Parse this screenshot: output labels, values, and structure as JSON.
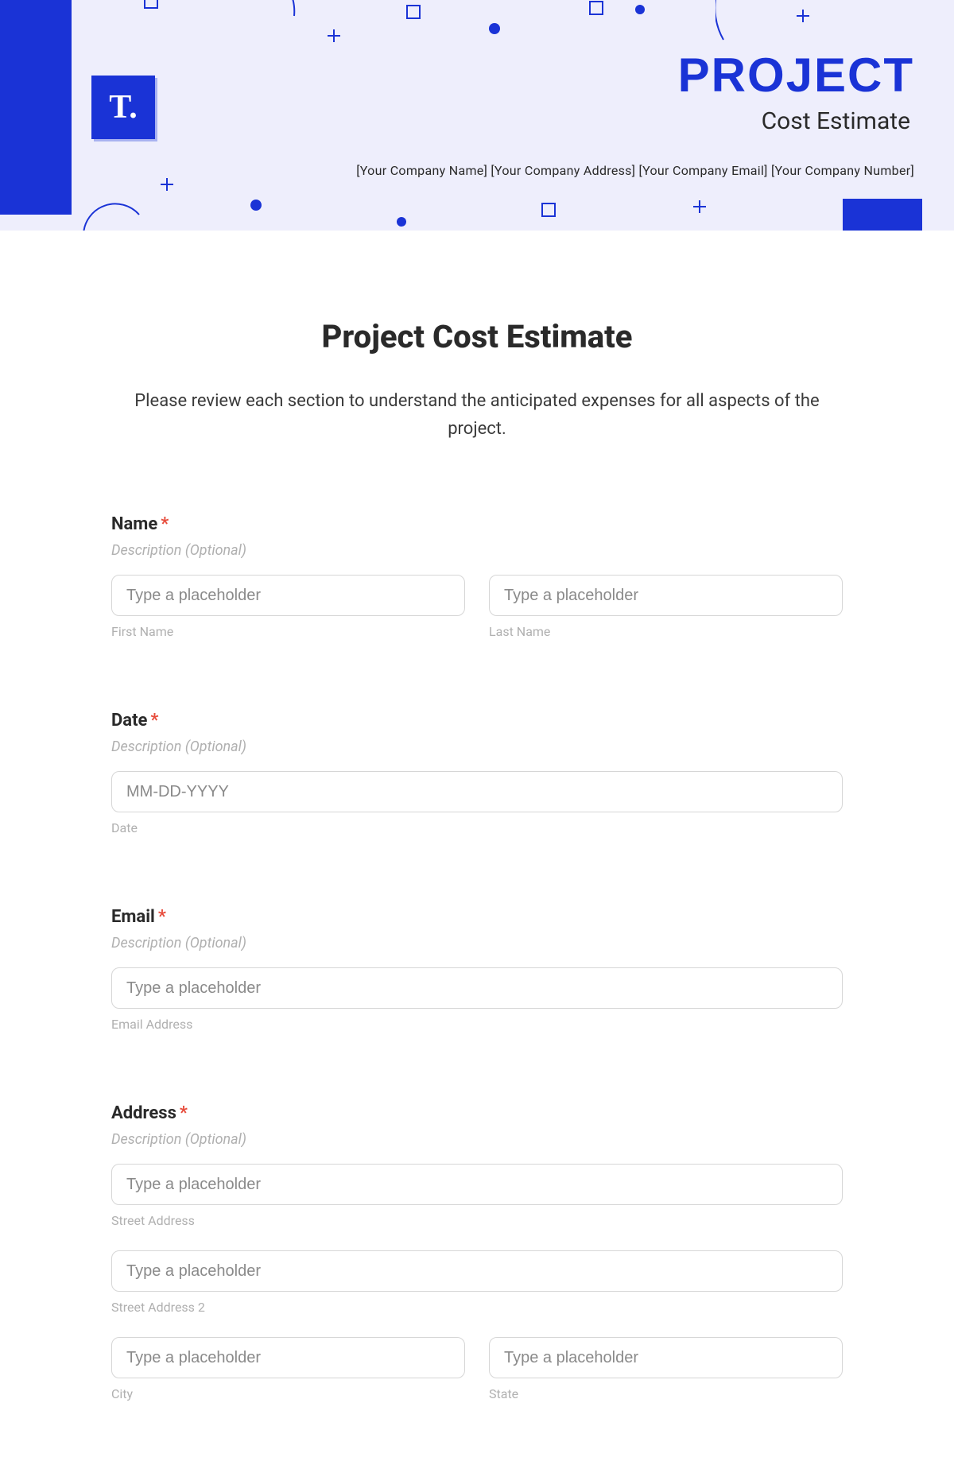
{
  "banner": {
    "logo_text": "T.",
    "title": "PROJECT",
    "subtitle": "Cost Estimate",
    "company_line": "[Your Company Name] [Your Company Address] [Your Company Email] [Your Company Number]"
  },
  "form": {
    "title": "Project Cost Estimate",
    "intro": "Please review each section to understand the anticipated expenses for all aspects of the project.",
    "desc_optional": "Description (Optional)",
    "required_mark": "*",
    "placeholder_generic": "Type a placeholder",
    "name": {
      "label": "Name",
      "first_sub": "First Name",
      "last_sub": "Last Name"
    },
    "date": {
      "label": "Date",
      "placeholder": "MM-DD-YYYY",
      "sub": "Date"
    },
    "email": {
      "label": "Email",
      "sub": "Email Address"
    },
    "address": {
      "label": "Address",
      "street1_sub": "Street Address",
      "street2_sub": "Street Address 2",
      "city_sub": "City",
      "state_sub": "State"
    }
  }
}
